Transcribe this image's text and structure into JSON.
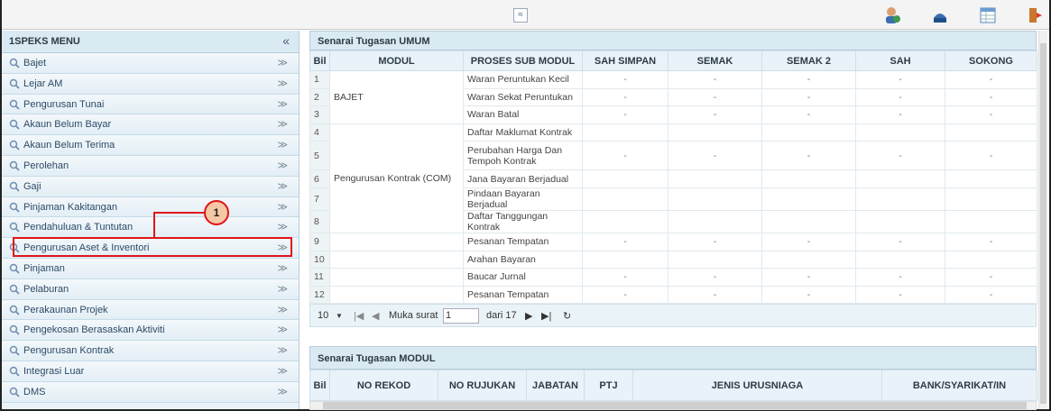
{
  "topbar": {
    "collapse_glyph": "≈",
    "icons": [
      "user-help-icon",
      "save-icon",
      "table-icon",
      "logout-icon"
    ]
  },
  "sidebar": {
    "title": "1SPEKS MENU",
    "collapse_glyph": "«",
    "items": [
      {
        "label": "Bajet"
      },
      {
        "label": "Lejar AM"
      },
      {
        "label": "Pengurusan Tunai"
      },
      {
        "label": "Akaun Belum Bayar"
      },
      {
        "label": "Akaun Belum Terima"
      },
      {
        "label": "Perolehan"
      },
      {
        "label": "Gaji"
      },
      {
        "label": "Pinjaman Kakitangan"
      },
      {
        "label": "Pendahuluan & Tuntutan"
      },
      {
        "label": "Pengurusan Aset & Inventori"
      },
      {
        "label": "Pinjaman"
      },
      {
        "label": "Pelaburan"
      },
      {
        "label": "Perakaunan Projek"
      },
      {
        "label": "Pengekosan Berasaskan Aktiviti"
      },
      {
        "label": "Pengurusan Kontrak"
      },
      {
        "label": "Integrasi Luar"
      },
      {
        "label": "DMS"
      }
    ],
    "chevron_glyph": "≫",
    "callout_number": "1"
  },
  "umum": {
    "title": "Senarai Tugasan UMUM",
    "headers": [
      "Bil",
      "MODUL",
      "PROSES SUB MODUL",
      "SAH SIMPAN",
      "SEMAK",
      "SEMAK 2",
      "SAH",
      "SOKONG"
    ],
    "rows": [
      {
        "bil": "1",
        "proses": "Waran Peruntukan Kecil",
        "v": [
          "-",
          "-",
          "-",
          "-",
          "-"
        ]
      },
      {
        "bil": "2",
        "proses": "Waran Sekat Peruntukan",
        "v": [
          "-",
          "-",
          "-",
          "-",
          "-"
        ]
      },
      {
        "bil": "3",
        "proses": "Waran Batal",
        "v": [
          "-",
          "-",
          "-",
          "-",
          "-"
        ]
      },
      {
        "bil": "4",
        "proses": "Daftar Maklumat Kontrak",
        "v": [
          "",
          "",
          "",
          "",
          ""
        ]
      },
      {
        "bil": "5",
        "proses": "Perubahan Harga Dan Tempoh Kontrak",
        "v": [
          "-",
          "-",
          "-",
          "-",
          "-"
        ]
      },
      {
        "bil": "6",
        "proses": "Jana Bayaran Berjadual",
        "v": [
          "",
          "",
          "",
          "",
          ""
        ]
      },
      {
        "bil": "7",
        "proses": "Pindaan Bayaran Berjadual",
        "v": [
          "",
          "",
          "",
          "",
          ""
        ]
      },
      {
        "bil": "8",
        "proses": "Daftar Tanggungan Kontrak",
        "v": [
          "",
          "",
          "",
          "",
          ""
        ]
      },
      {
        "bil": "9",
        "proses": "Pesanan Tempatan",
        "v": [
          "-",
          "-",
          "-",
          "-",
          "-"
        ]
      },
      {
        "bil": "10",
        "proses": "Arahan Bayaran",
        "v": [
          "",
          "",
          "",
          "",
          ""
        ]
      },
      {
        "bil": "11",
        "proses": "Baucar Jurnal",
        "v": [
          "-",
          "-",
          "-",
          "-",
          "-"
        ]
      },
      {
        "bil": "12",
        "proses": "Pesanan Tempatan",
        "v": [
          "-",
          "-",
          "-",
          "-",
          "-"
        ]
      }
    ],
    "modul_bajet": "BAJET",
    "modul_kontrak": "Pengurusan Kontrak (COM)",
    "pager": {
      "page_size": "10",
      "page_label": "Muka surat",
      "page_value": "1",
      "of_label": "dari 17"
    }
  },
  "modul": {
    "title": "Senarai Tugasan MODUL",
    "headers": [
      "Bil",
      "NO REKOD",
      "NO RUJUKAN",
      "JABATAN",
      "PTJ",
      "JENIS URUSNIAGA",
      "BANK/SYARIKAT/IN"
    ]
  }
}
